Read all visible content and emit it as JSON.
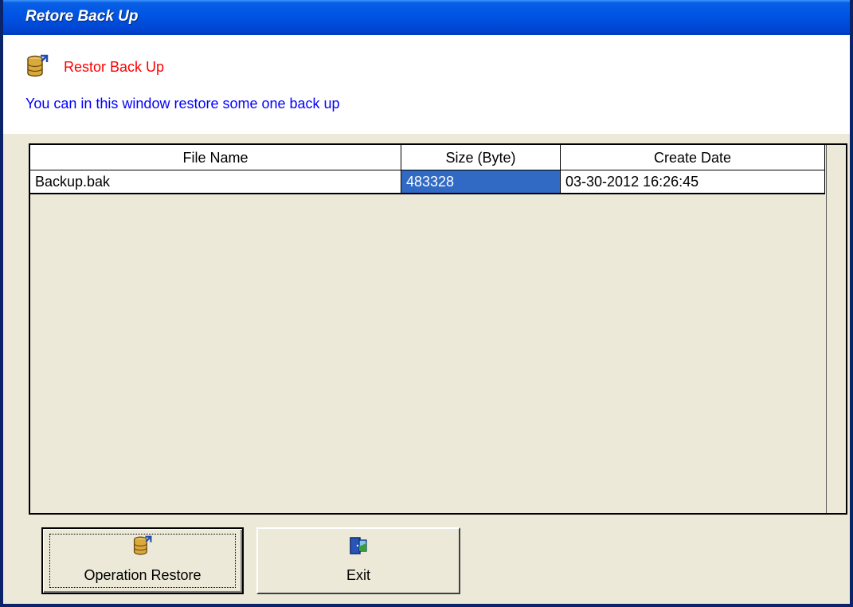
{
  "window": {
    "title": "Retore Back Up"
  },
  "header": {
    "title": "Restor Back Up",
    "description": "You can in this window restore some one back up"
  },
  "table": {
    "columns": [
      "File Name",
      "Size (Byte)",
      "Create Date"
    ],
    "rows": [
      {
        "file_name": "Backup.bak",
        "size": "483328",
        "create_date": "03-30-2012 16:26:45"
      }
    ]
  },
  "buttons": {
    "restore_label": "Operation Restore",
    "exit_label": "Exit"
  },
  "icons": {
    "header": "database-restore-icon",
    "restore": "database-restore-icon",
    "exit": "exit-door-icon"
  },
  "colors": {
    "title_red": "#ff0000",
    "description_blue": "#0000ff",
    "selection": "#316ac5"
  }
}
